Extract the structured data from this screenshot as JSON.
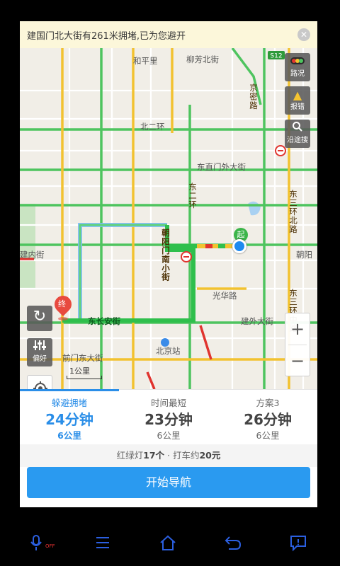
{
  "notice": {
    "text": "建国门北大街有261米拥堵,已为您避开",
    "close_icon": "close-icon"
  },
  "map": {
    "place_labels": [
      "和平里",
      "柳芳北街",
      "北二环",
      "东直门外大街",
      "光华路",
      "北京站",
      "建外大街",
      "前门东大街",
      "建内街",
      "朝阳"
    ],
    "road_labels": {
      "east_chang_an": "东长安街",
      "chaoyang_nanxiaojie": "朝阳门南小街",
      "dong_er_huan": "东二环",
      "dong_san_huan_bei": "东三环北路",
      "dong_san_huan_zhong": "东三环中路",
      "jingmi": "京密路"
    },
    "highway_badge": "S12",
    "start_marker": "起",
    "end_marker": "终",
    "tools": {
      "traffic": {
        "label": "路况",
        "icon": "traffic-light-icon"
      },
      "report": {
        "label": "报错",
        "icon": "warning-icon"
      },
      "search_along": {
        "label": "沿途搜",
        "icon": "search-icon"
      }
    },
    "left_tools": {
      "refresh_icon": "refresh-icon",
      "preference": {
        "label": "偏好",
        "icon": "preference-icon"
      },
      "locate_icon": "locate-icon"
    },
    "zoom": {
      "in": "+",
      "out": "−"
    },
    "scale": "1公里",
    "colors": {
      "route_green": "#2fbf4c",
      "route_blue": "#7fb8ff",
      "traffic_yellow": "#f2c230",
      "traffic_red": "#e0342f"
    }
  },
  "routes": [
    {
      "name": "躲避拥堵",
      "time": "24分钟",
      "distance": "6公里",
      "active": true
    },
    {
      "name": "时间最短",
      "time": "23分钟",
      "distance": "6公里",
      "active": false
    },
    {
      "name": "方案3",
      "time": "26分钟",
      "distance": "6公里",
      "active": false
    }
  ],
  "summary": {
    "lights_prefix": "红绿灯",
    "lights_value": "17个",
    "separator": " · ",
    "taxi_prefix": "打车约",
    "taxi_value": "20元"
  },
  "start_button": "开始导航",
  "sysnav": {
    "mic_icon": "microphone-icon",
    "mic_off": "OFF",
    "menu_icon": "menu-icon",
    "home_icon": "home-icon",
    "back_icon": "back-icon",
    "feedback_icon": "feedback-icon"
  }
}
